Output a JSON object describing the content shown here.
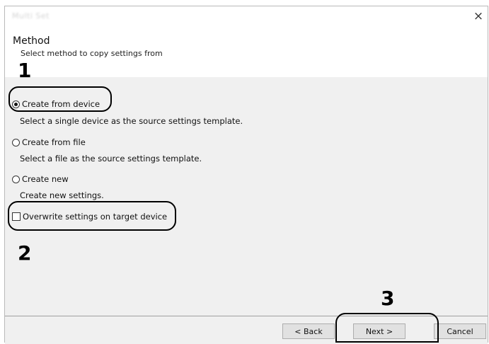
{
  "window": {
    "title": "Multi Set",
    "close_icon": "×"
  },
  "header": {
    "title": "Method",
    "subtitle": "Select method to copy settings from"
  },
  "options": [
    {
      "label": "Create from device",
      "checked": true,
      "description": "Select a single device as the source settings template."
    },
    {
      "label": "Create from file",
      "checked": false,
      "description": "Select a file as the source settings template."
    },
    {
      "label": "Create new",
      "checked": false,
      "description": "Create new settings."
    }
  ],
  "overwrite": {
    "label": "Overwrite settings on target device",
    "checked": false
  },
  "buttons": {
    "back": "< Back",
    "next": "Next >",
    "cancel": "Cancel"
  },
  "callouts": {
    "one": "1",
    "two": "2",
    "three": "3"
  }
}
